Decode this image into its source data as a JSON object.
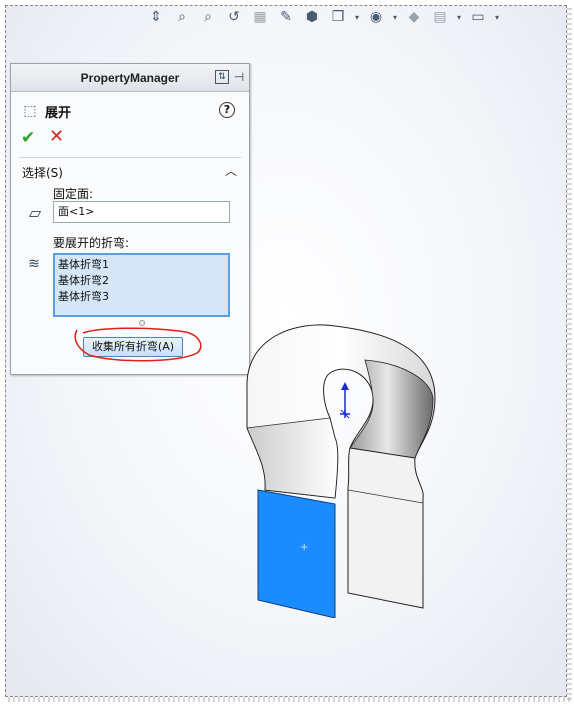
{
  "toolbar": {
    "icons": [
      "standard-views-icon",
      "zoom-to-fit-icon",
      "zoom-area-icon",
      "previous-view-icon",
      "section-view-icon",
      "dynamic-annotation-icon",
      "view-orientation-icon",
      "display-style-icon",
      "hide-show-items-icon",
      "edit-appearance-icon",
      "apply-scene-icon",
      "view-settings-icon"
    ]
  },
  "property_manager": {
    "title": "PropertyManager",
    "feature_name": "展开",
    "help": "?",
    "ok": "✔",
    "cancel": "✕",
    "selection_group": {
      "title": "选择(S)",
      "fixed_face_label": "固定面:",
      "fixed_face_value": "面<1>",
      "bends_label": "要展开的折弯:",
      "bends": [
        "基体折弯1",
        "基体折弯2",
        "基体折弯3"
      ],
      "collect_button": "收集所有折弯(A)"
    }
  },
  "colors": {
    "selected_face": "#1a8cff",
    "list_bg": "#d6e6f7",
    "annotation": "#e0201a"
  }
}
